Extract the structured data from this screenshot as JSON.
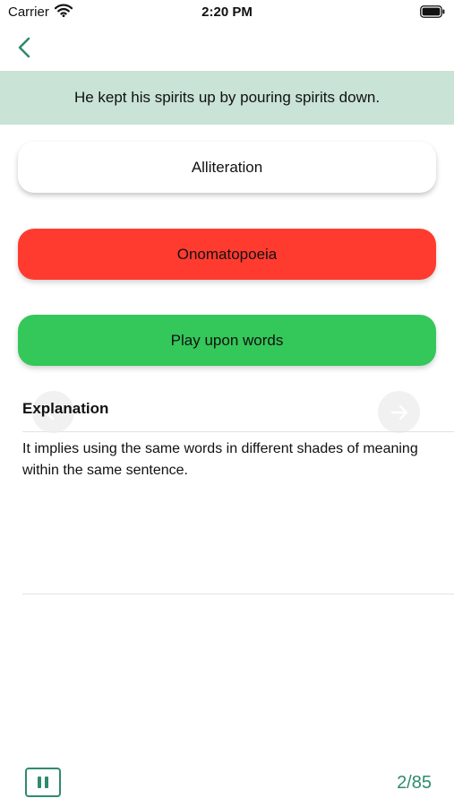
{
  "status_bar": {
    "carrier": "Carrier",
    "time": "2:20 PM",
    "icons": [
      "wifi-icon",
      "battery-icon"
    ]
  },
  "colors": {
    "accent": "#2e8b6e",
    "banner": "#c9e3d6",
    "wrong": "#ff3b30",
    "correct": "#34c759"
  },
  "question": {
    "text": "He kept his spirits up by pouring spirits down."
  },
  "options": [
    {
      "label": "Alliteration",
      "state": "neutral"
    },
    {
      "label": "Onomatopoeia",
      "state": "wrong"
    },
    {
      "label": "Play upon words",
      "state": "correct"
    }
  ],
  "explanation": {
    "title": "Explanation",
    "text": "It implies using the same words in different shades of meaning within the same sentence."
  },
  "footer": {
    "progress": "2/85",
    "pause_icon": "pause-icon"
  }
}
